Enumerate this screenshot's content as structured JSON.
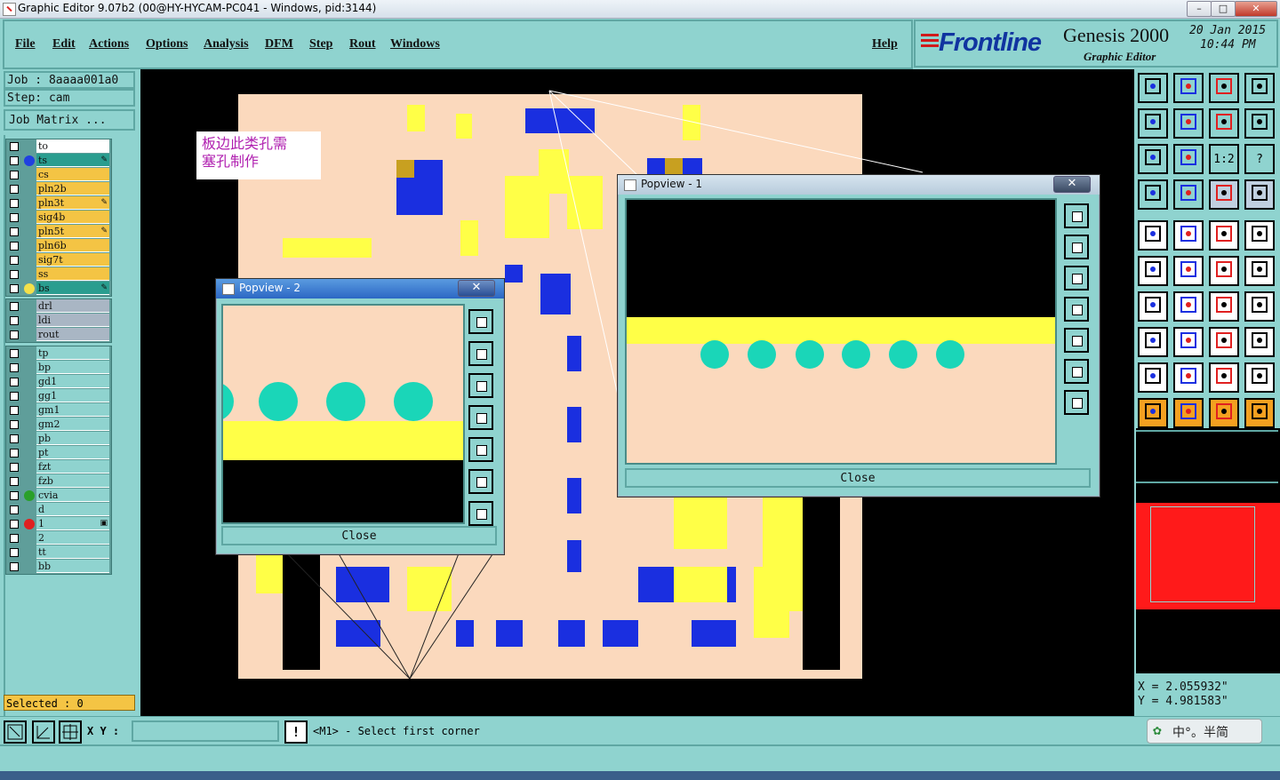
{
  "window": {
    "title": "Graphic Editor 9.07b2 (00@HY-HYCAM-PC041 - Windows, pid:3144)",
    "min_label": "–",
    "max_label": "□",
    "close_label": "✕"
  },
  "menu": {
    "items": [
      "File",
      "Edit",
      "Actions",
      "Options",
      "Analysis",
      "DFM",
      "Step",
      "Rout",
      "Windows"
    ],
    "help": "Help"
  },
  "brand": {
    "logo": "Frontline",
    "product": "Genesis 2000",
    "subtitle": "Graphic Editor",
    "date": "20 Jan 2015",
    "time": "10:44 PM"
  },
  "job": {
    "job_line": "Job : 8aaaa001a0",
    "step_line": "Step: cam",
    "matrix_button": "Job Matrix ..."
  },
  "layers": {
    "group1": [
      {
        "name": "to",
        "color": "#ffffff",
        "dot": "",
        "flag": ""
      },
      {
        "name": "ts",
        "color": "#2a9d8f",
        "dot": "#2040e0",
        "flag": "✎"
      },
      {
        "name": "cs",
        "color": "#f4c444",
        "dot": "",
        "flag": ""
      },
      {
        "name": "pln2b",
        "color": "#f4c444",
        "dot": "",
        "flag": ""
      },
      {
        "name": "pln3t",
        "color": "#f4c444",
        "dot": "",
        "flag": "✎"
      },
      {
        "name": "sig4b",
        "color": "#f4c444",
        "dot": "",
        "flag": ""
      },
      {
        "name": "pln5t",
        "color": "#f4c444",
        "dot": "",
        "flag": "✎"
      },
      {
        "name": "pln6b",
        "color": "#f4c444",
        "dot": "",
        "flag": ""
      },
      {
        "name": "sig7t",
        "color": "#f4c444",
        "dot": "",
        "flag": ""
      },
      {
        "name": "ss",
        "color": "#f4c444",
        "dot": "",
        "flag": ""
      },
      {
        "name": "bs",
        "color": "#2a9d8f",
        "dot": "#f4e04a",
        "flag": "✎"
      }
    ],
    "group2": [
      {
        "name": "drl",
        "color": "#a9b6c4",
        "dot": "",
        "flag": ""
      },
      {
        "name": "ldi",
        "color": "#a9b6c4",
        "dot": "",
        "flag": ""
      },
      {
        "name": "rout",
        "color": "#a9b6c4",
        "dot": "",
        "flag": ""
      }
    ],
    "group3": [
      {
        "name": "tp",
        "color": "#8fd3cf",
        "dot": "",
        "flag": ""
      },
      {
        "name": "bp",
        "color": "#8fd3cf",
        "dot": "",
        "flag": ""
      },
      {
        "name": "gd1",
        "color": "#8fd3cf",
        "dot": "",
        "flag": ""
      },
      {
        "name": "gg1",
        "color": "#8fd3cf",
        "dot": "",
        "flag": ""
      },
      {
        "name": "gm1",
        "color": "#8fd3cf",
        "dot": "",
        "flag": ""
      },
      {
        "name": "gm2",
        "color": "#8fd3cf",
        "dot": "",
        "flag": ""
      },
      {
        "name": "pb",
        "color": "#8fd3cf",
        "dot": "",
        "flag": ""
      },
      {
        "name": "pt",
        "color": "#8fd3cf",
        "dot": "",
        "flag": ""
      },
      {
        "name": "fzt",
        "color": "#8fd3cf",
        "dot": "",
        "flag": ""
      },
      {
        "name": "fzb",
        "color": "#8fd3cf",
        "dot": "",
        "flag": ""
      },
      {
        "name": "cvia",
        "color": "#8fd3cf",
        "dot": "#2aa02a",
        "flag": ""
      },
      {
        "name": "d",
        "color": "#8fd3cf",
        "dot": "",
        "flag": ""
      },
      {
        "name": "1",
        "color": "#8fd3cf",
        "dot": "#e02020",
        "flag": "▣"
      },
      {
        "name": "2",
        "color": "#8fd3cf",
        "dot": "",
        "flag": ""
      },
      {
        "name": "tt",
        "color": "#8fd3cf",
        "dot": "",
        "flag": ""
      },
      {
        "name": "bb",
        "color": "#8fd3cf",
        "dot": "",
        "flag": ""
      }
    ]
  },
  "selected": "Selected : 0",
  "annotation": {
    "line1": "板边此类孔需",
    "line2": "塞孔制作"
  },
  "popview1": {
    "title": "Popview - 1",
    "close": "Close",
    "x_label": "✕"
  },
  "popview2": {
    "title": "Popview - 2",
    "close": "Close",
    "x_label": "✕"
  },
  "toolbar_text": {
    "ratio": "1:2",
    "help": "?"
  },
  "coords": {
    "x": "X = 2.055932\"",
    "y": "Y = 4.981583\""
  },
  "command": {
    "xy_label": "X Y :",
    "xy_value": "",
    "prompt": "<M1> - Select first corner"
  },
  "ime": {
    "text": "中°。半简"
  },
  "colors": {
    "panel": "#8fd3cf",
    "board": "#fbd9bd",
    "copper": "#ffff47",
    "pad_blue": "#1a2fe0",
    "hole": "#1ad6b8",
    "active_layer": "#2a9d8f"
  }
}
